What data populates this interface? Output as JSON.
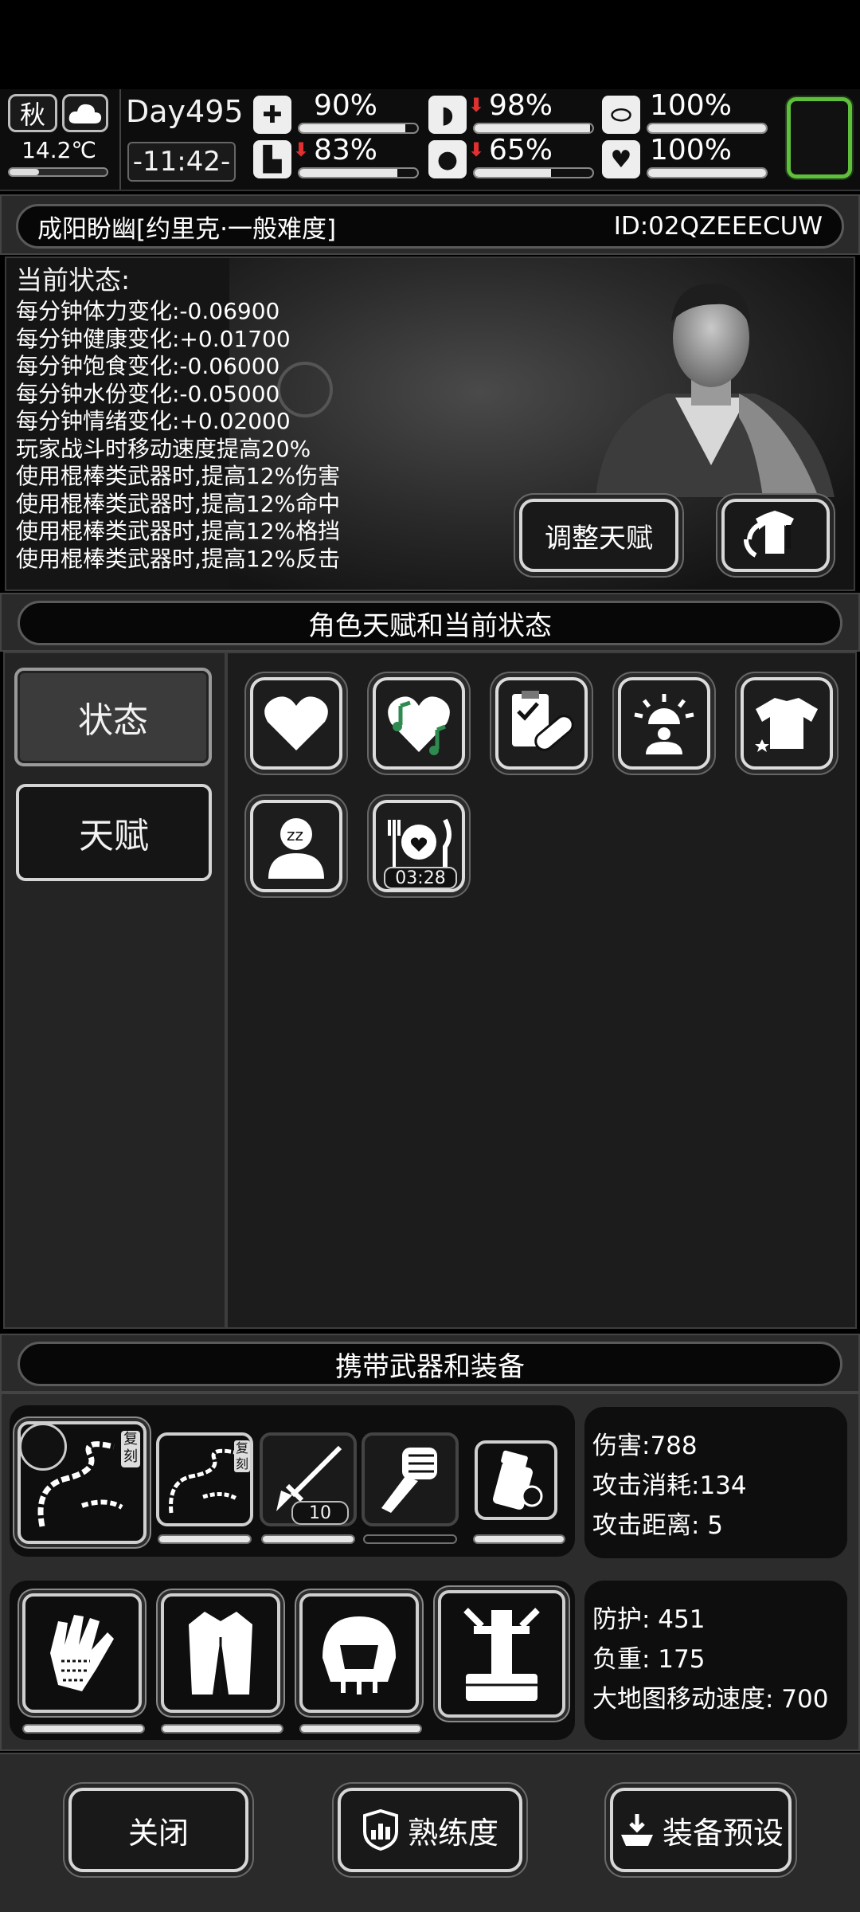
{
  "topbar": {
    "season": "秋",
    "weather_icon": "cloud-icon",
    "temperature": "14.2℃",
    "day": "Day495",
    "time": "-11:42-",
    "stats": [
      {
        "name": "health",
        "icon": "medkit-icon",
        "value": "90%",
        "level": 0.9,
        "arrow": false
      },
      {
        "name": "hunger",
        "icon": "stomach-icon",
        "value": "98%",
        "level": 0.98,
        "arrow": true
      },
      {
        "name": "energy",
        "icon": "pill-icon",
        "value": "100%",
        "level": 1.0,
        "arrow": false
      },
      {
        "name": "stamina",
        "icon": "boot-icon",
        "value": "83%",
        "level": 0.83,
        "arrow": true
      },
      {
        "name": "thirst",
        "icon": "water-drop-icon",
        "value": "65%",
        "level": 0.65,
        "arrow": true
      },
      {
        "name": "mood",
        "icon": "heart-icon",
        "value": "100%",
        "level": 1.0,
        "arrow": false
      }
    ]
  },
  "character": {
    "name": "成阳盼幽[约里克·一般难度]",
    "id": "ID:02QZEEECUW"
  },
  "status_panel": {
    "title": "当前状态:",
    "lines": [
      "每分钟体力变化:-0.06900",
      "每分钟健康变化:+0.01700",
      "每分钟饱食变化:-0.06000",
      "每分钟水份变化:-0.05000",
      "每分钟情绪变化:+0.02000",
      "玩家战斗时移动速度提高20%",
      "使用棍棒类武器时,提高12%伤害",
      "使用棍棒类武器时,提高12%命中",
      "使用棍棒类武器时,提高12%格挡",
      "使用棍棒类武器时,提高12%反击"
    ],
    "adjust_talent_label": "调整天赋",
    "outfit_icon": "outfit-swap-icon"
  },
  "talent_section": {
    "header": "角色天赋和当前状态",
    "tabs": [
      {
        "label": "状态",
        "active": true
      },
      {
        "label": "天赋",
        "active": false
      }
    ],
    "status_icons": [
      {
        "icon": "heart-icon"
      },
      {
        "icon": "music-heart-icon"
      },
      {
        "icon": "medical-bandage-icon"
      },
      {
        "icon": "alarm-person-icon"
      },
      {
        "icon": "clean-shirt-icon"
      },
      {
        "icon": "sleepy-person-icon"
      },
      {
        "icon": "meal-icon",
        "timer": "03:28"
      }
    ]
  },
  "equipment_section": {
    "header": "携带武器和装备",
    "weapons": [
      {
        "icon": "thorn-whip-icon",
        "badge": "复刻",
        "durability": 1.0
      },
      {
        "icon": "thorn-whip-small-icon",
        "badge": "复刻",
        "durability": 1.0
      },
      {
        "icon": "spear-icon",
        "count": "10",
        "durability": 1.0
      },
      {
        "icon": "fist-icon",
        "durability": 0.0
      },
      {
        "icon": "lighter-icon",
        "durability": 1.0
      }
    ],
    "weapon_stats": {
      "damage": "伤害:788",
      "cost": "攻击消耗:134",
      "range": "攻击距离: 5"
    },
    "armor": [
      {
        "icon": "gloves-icon",
        "durability": 1.0
      },
      {
        "icon": "coat-icon",
        "durability": 1.0
      },
      {
        "icon": "helmet-icon",
        "durability": 1.0
      },
      {
        "icon": "backpack-frame-icon",
        "durability": 1.0
      }
    ],
    "armor_stats": {
      "defense": "防护: 451",
      "weight": "负重: 175",
      "speed": "大地图移动速度: 700"
    }
  },
  "bottom_buttons": {
    "close": "关闭",
    "proficiency": "熟练度",
    "preset": "装备预设"
  }
}
